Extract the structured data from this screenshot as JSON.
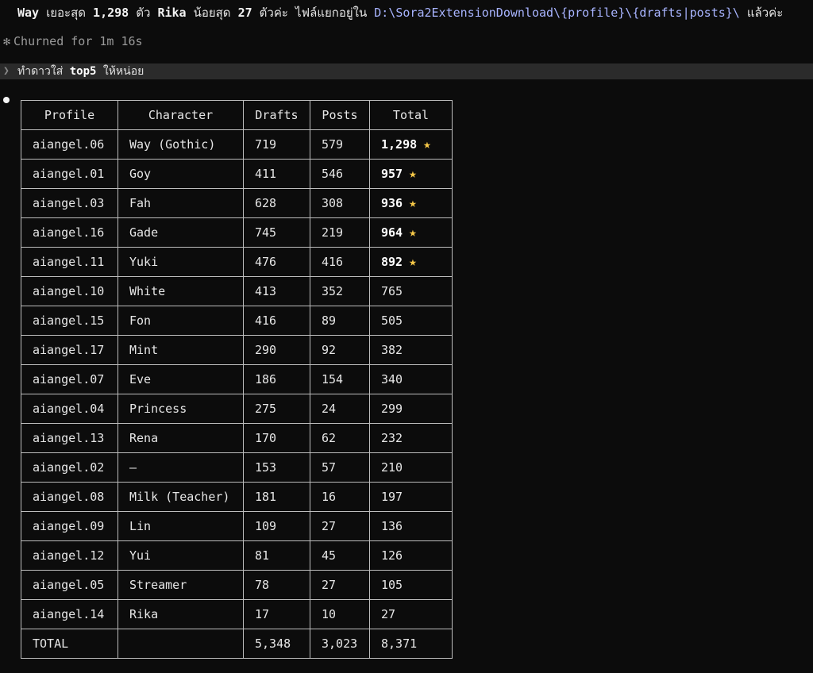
{
  "summary": {
    "a": "Way",
    "b": " เยอะสุด ",
    "c": "1,298",
    "d": " ตัว ",
    "e": "Rika",
    "f": " น้อยสุด ",
    "g": "27",
    "h": " ตัวค่ะ  ไฟล์แยกอยู่ใน ",
    "path": "D:\\Sora2ExtensionDownload\\{profile}\\{drafts|posts}\\",
    "tail": " แล้วค่ะ"
  },
  "status": {
    "icon": "✻",
    "text": "Churned for 1m 16s"
  },
  "prompt": {
    "caret": "❯",
    "text_a": "ทำดาวใส่ ",
    "text_b": "top5",
    "text_c": " ให้หน่อย"
  },
  "table": {
    "headers": [
      "Profile",
      "Character",
      "Drafts",
      "Posts",
      "Total"
    ],
    "star_icon": "★",
    "star_color": "#f7c948",
    "rows": [
      {
        "profile": "aiangel.06",
        "character": "Way (Gothic)",
        "drafts": "719",
        "posts": "579",
        "total": "1,298",
        "star": true
      },
      {
        "profile": "aiangel.01",
        "character": "Goy",
        "drafts": "411",
        "posts": "546",
        "total": "957",
        "star": true
      },
      {
        "profile": "aiangel.03",
        "character": "Fah",
        "drafts": "628",
        "posts": "308",
        "total": "936",
        "star": true
      },
      {
        "profile": "aiangel.16",
        "character": "Gade",
        "drafts": "745",
        "posts": "219",
        "total": "964",
        "star": true
      },
      {
        "profile": "aiangel.11",
        "character": "Yuki",
        "drafts": "476",
        "posts": "416",
        "total": "892",
        "star": true
      },
      {
        "profile": "aiangel.10",
        "character": "White",
        "drafts": "413",
        "posts": "352",
        "total": "765",
        "star": false
      },
      {
        "profile": "aiangel.15",
        "character": "Fon",
        "drafts": "416",
        "posts": "89",
        "total": "505",
        "star": false
      },
      {
        "profile": "aiangel.17",
        "character": "Mint",
        "drafts": "290",
        "posts": "92",
        "total": "382",
        "star": false
      },
      {
        "profile": "aiangel.07",
        "character": "Eve",
        "drafts": "186",
        "posts": "154",
        "total": "340",
        "star": false
      },
      {
        "profile": "aiangel.04",
        "character": "Princess",
        "drafts": "275",
        "posts": "24",
        "total": "299",
        "star": false
      },
      {
        "profile": "aiangel.13",
        "character": "Rena",
        "drafts": "170",
        "posts": "62",
        "total": "232",
        "star": false
      },
      {
        "profile": "aiangel.02",
        "character": "–",
        "drafts": "153",
        "posts": "57",
        "total": "210",
        "star": false
      },
      {
        "profile": "aiangel.08",
        "character": "Milk (Teacher)",
        "drafts": "181",
        "posts": "16",
        "total": "197",
        "star": false
      },
      {
        "profile": "aiangel.09",
        "character": "Lin",
        "drafts": "109",
        "posts": "27",
        "total": "136",
        "star": false
      },
      {
        "profile": "aiangel.12",
        "character": "Yui",
        "drafts": "81",
        "posts": "45",
        "total": "126",
        "star": false
      },
      {
        "profile": "aiangel.05",
        "character": "Streamer",
        "drafts": "78",
        "posts": "27",
        "total": "105",
        "star": false
      },
      {
        "profile": "aiangel.14",
        "character": "Rika",
        "drafts": "17",
        "posts": "10",
        "total": "27",
        "star": false
      },
      {
        "profile": "TOTAL",
        "character": "",
        "drafts": "5,348",
        "posts": "3,023",
        "total": "8,371",
        "star": false
      }
    ]
  }
}
